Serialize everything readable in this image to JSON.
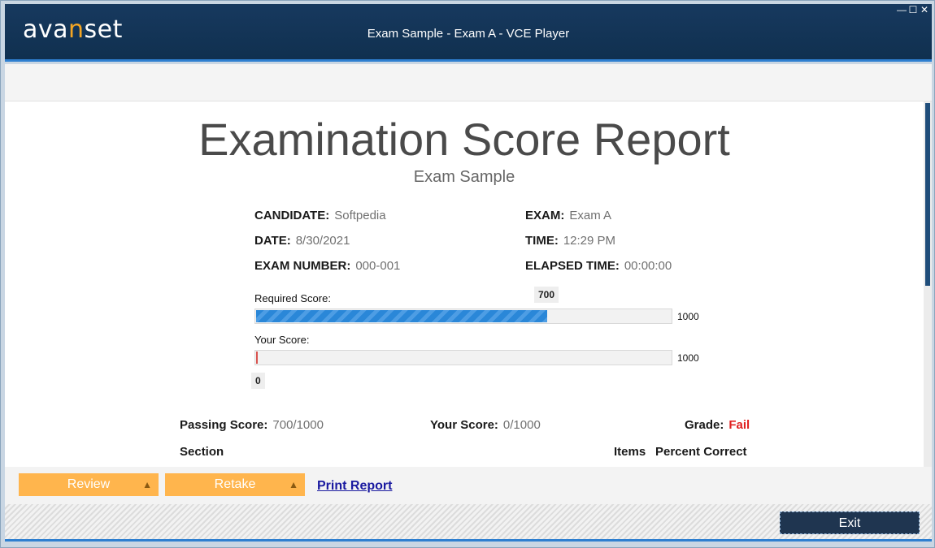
{
  "titlebar": {
    "logo_pre": "ava",
    "logo_accent": "n",
    "logo_post": "set",
    "title": "Exam Sample - Exam A - VCE Player",
    "minimize": "—",
    "maximize": "☐",
    "close": "✕"
  },
  "report": {
    "title": "Examination Score Report",
    "subtitle": "Exam Sample",
    "fields": {
      "candidate_label": "CANDIDATE:",
      "candidate_value": "Softpedia",
      "exam_label": "EXAM:",
      "exam_value": "Exam A",
      "date_label": "DATE:",
      "date_value": "8/30/2021",
      "time_label": "TIME:",
      "time_value": "12:29 PM",
      "exam_number_label": "EXAM NUMBER:",
      "exam_number_value": "000-001",
      "elapsed_label": "ELAPSED TIME:",
      "elapsed_value": "00:00:00"
    },
    "required_score": {
      "label": "Required Score:",
      "value": 700,
      "max": 1000,
      "marker": "700",
      "max_label": "1000"
    },
    "your_score": {
      "label": "Your Score:",
      "value": 0,
      "max": 1000,
      "marker": "0",
      "max_label": "1000"
    },
    "summary": {
      "passing_label": "Passing Score:",
      "passing_value": "700/1000",
      "yourscore_label": "Your Score:",
      "yourscore_value": "0/1000",
      "grade_label": "Grade:",
      "grade_value": "Fail"
    },
    "table_headers": {
      "section": "Section",
      "items": "Items",
      "percent": "Percent Correct"
    }
  },
  "actions": {
    "review": "Review",
    "retake": "Retake",
    "print": "Print Report",
    "dropdown_arrow": "▲"
  },
  "footer": {
    "exit": "Exit"
  },
  "colors": {
    "titlebar": "#17395f",
    "accent_blue": "#2e7fd0",
    "orange_button": "#ffb54d",
    "fail_red": "#e02020",
    "bar_fill": "#2a87d8"
  }
}
